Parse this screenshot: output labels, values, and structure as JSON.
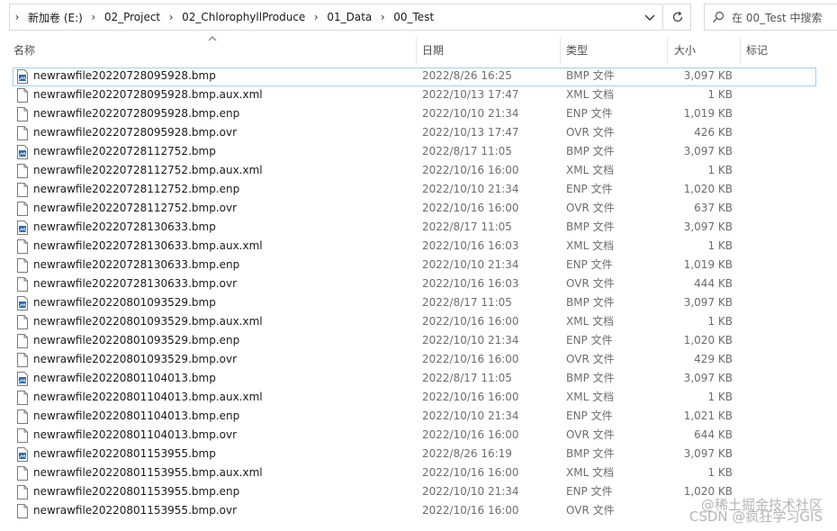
{
  "address": {
    "crumbs": [
      "新加卷 (E:)",
      "02_Project",
      "02_ChlorophyllProduce",
      "01_Data",
      "00_Test"
    ]
  },
  "search": {
    "placeholder": "在 00_Test 中搜索"
  },
  "columns": {
    "name": "名称",
    "date": "日期",
    "type": "类型",
    "size": "大小",
    "tags": "标记"
  },
  "files": [
    {
      "name": "newrawfile20220728095928.bmp",
      "date": "2022/8/26 16:25",
      "type": "BMP 文件",
      "size": "3,097 KB",
      "icon": "bitmap-file-icon",
      "selected": true
    },
    {
      "name": "newrawfile20220728095928.bmp.aux.xml",
      "date": "2022/10/13 17:47",
      "type": "XML 文档",
      "size": "1 KB",
      "icon": "document-file-icon"
    },
    {
      "name": "newrawfile20220728095928.bmp.enp",
      "date": "2022/10/10 21:34",
      "type": "ENP 文件",
      "size": "1,019 KB",
      "icon": "document-file-icon"
    },
    {
      "name": "newrawfile20220728095928.bmp.ovr",
      "date": "2022/10/13 17:47",
      "type": "OVR 文件",
      "size": "426 KB",
      "icon": "document-file-icon"
    },
    {
      "name": "newrawfile20220728112752.bmp",
      "date": "2022/8/17 11:05",
      "type": "BMP 文件",
      "size": "3,097 KB",
      "icon": "bitmap-file-icon"
    },
    {
      "name": "newrawfile20220728112752.bmp.aux.xml",
      "date": "2022/10/16 16:00",
      "type": "XML 文档",
      "size": "1 KB",
      "icon": "document-file-icon"
    },
    {
      "name": "newrawfile20220728112752.bmp.enp",
      "date": "2022/10/10 21:34",
      "type": "ENP 文件",
      "size": "1,020 KB",
      "icon": "document-file-icon"
    },
    {
      "name": "newrawfile20220728112752.bmp.ovr",
      "date": "2022/10/16 16:00",
      "type": "OVR 文件",
      "size": "637 KB",
      "icon": "document-file-icon"
    },
    {
      "name": "newrawfile20220728130633.bmp",
      "date": "2022/8/17 11:05",
      "type": "BMP 文件",
      "size": "3,097 KB",
      "icon": "bitmap-file-icon"
    },
    {
      "name": "newrawfile20220728130633.bmp.aux.xml",
      "date": "2022/10/16 16:03",
      "type": "XML 文档",
      "size": "1 KB",
      "icon": "document-file-icon"
    },
    {
      "name": "newrawfile20220728130633.bmp.enp",
      "date": "2022/10/10 21:34",
      "type": "ENP 文件",
      "size": "1,019 KB",
      "icon": "document-file-icon"
    },
    {
      "name": "newrawfile20220728130633.bmp.ovr",
      "date": "2022/10/16 16:03",
      "type": "OVR 文件",
      "size": "444 KB",
      "icon": "document-file-icon"
    },
    {
      "name": "newrawfile20220801093529.bmp",
      "date": "2022/8/17 11:05",
      "type": "BMP 文件",
      "size": "3,097 KB",
      "icon": "bitmap-file-icon"
    },
    {
      "name": "newrawfile20220801093529.bmp.aux.xml",
      "date": "2022/10/16 16:00",
      "type": "XML 文档",
      "size": "1 KB",
      "icon": "document-file-icon"
    },
    {
      "name": "newrawfile20220801093529.bmp.enp",
      "date": "2022/10/10 21:34",
      "type": "ENP 文件",
      "size": "1,020 KB",
      "icon": "document-file-icon"
    },
    {
      "name": "newrawfile20220801093529.bmp.ovr",
      "date": "2022/10/16 16:00",
      "type": "OVR 文件",
      "size": "429 KB",
      "icon": "document-file-icon"
    },
    {
      "name": "newrawfile20220801104013.bmp",
      "date": "2022/8/17 11:05",
      "type": "BMP 文件",
      "size": "3,097 KB",
      "icon": "bitmap-file-icon"
    },
    {
      "name": "newrawfile20220801104013.bmp.aux.xml",
      "date": "2022/10/16 16:00",
      "type": "XML 文档",
      "size": "1 KB",
      "icon": "document-file-icon"
    },
    {
      "name": "newrawfile20220801104013.bmp.enp",
      "date": "2022/10/10 21:34",
      "type": "ENP 文件",
      "size": "1,021 KB",
      "icon": "document-file-icon"
    },
    {
      "name": "newrawfile20220801104013.bmp.ovr",
      "date": "2022/10/16 16:00",
      "type": "OVR 文件",
      "size": "644 KB",
      "icon": "document-file-icon"
    },
    {
      "name": "newrawfile20220801153955.bmp",
      "date": "2022/8/26 16:19",
      "type": "BMP 文件",
      "size": "3,097 KB",
      "icon": "bitmap-file-icon"
    },
    {
      "name": "newrawfile20220801153955.bmp.aux.xml",
      "date": "2022/10/16 16:00",
      "type": "XML 文档",
      "size": "1 KB",
      "icon": "document-file-icon"
    },
    {
      "name": "newrawfile20220801153955.bmp.enp",
      "date": "2022/10/10 21:34",
      "type": "ENP 文件",
      "size": "1,020 KB",
      "icon": "document-file-icon"
    },
    {
      "name": "newrawfile20220801153955.bmp.ovr",
      "date": "2022/10/16 16:00",
      "type": "OVR 文件",
      "size": "",
      "icon": "document-file-icon"
    }
  ],
  "watermark": {
    "line1": "@稀土掘金技术社区",
    "line2": "CSDN @疯狂学习GIS"
  },
  "colors": {
    "selection_border": "#99d1ff",
    "bitmap_icon": "#2b6cb0",
    "muted_text": "#6d6d6d"
  }
}
